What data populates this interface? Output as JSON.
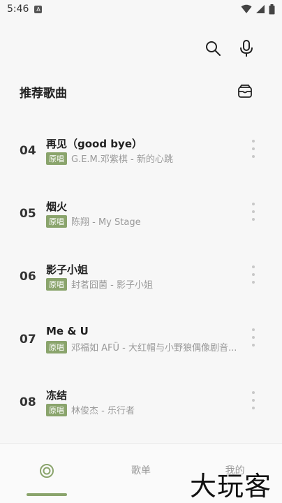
{
  "status_bar": {
    "time": "5:46",
    "notif_letter": "A"
  },
  "section": {
    "title": "推荐歌曲"
  },
  "songs": [
    {
      "index": "04",
      "title": "再见（good bye）",
      "badge": "原唱",
      "artist": "G.E.M.邓紫棋 - 新的心跳"
    },
    {
      "index": "05",
      "title": "烟火",
      "badge": "原唱",
      "artist": "陈翔 - My Stage"
    },
    {
      "index": "06",
      "title": "影子小姐",
      "badge": "原唱",
      "artist": "封茗囧菌 - 影子小姐"
    },
    {
      "index": "07",
      "title": "Me & U",
      "badge": "原唱",
      "artist": "邓福如 AFÜ - 大红帽与小野狼偶像剧音..."
    },
    {
      "index": "08",
      "title": "冻结",
      "badge": "原唱",
      "artist": "林俊杰 - 乐行者"
    }
  ],
  "bottom_nav": {
    "playlist_label": "歌单",
    "mine_label": "我的"
  },
  "watermark": "大玩客",
  "colors": {
    "accent": "#8aa46c",
    "background": "#f7f7f7"
  },
  "icons": {
    "search": "search-icon",
    "mic": "mic-icon",
    "library": "library-box-icon",
    "home": "target-icon",
    "more": "more-vertical-icon"
  }
}
